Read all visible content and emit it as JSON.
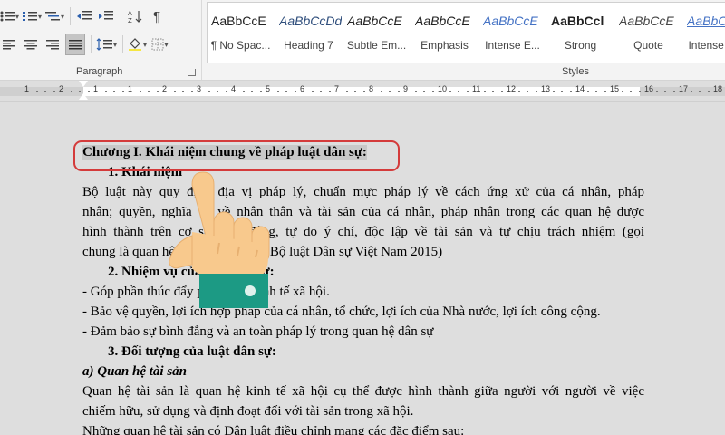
{
  "ribbon": {
    "paragraph_label": "Paragraph",
    "styles_label": "Styles",
    "styles": [
      {
        "sample": "AaBbCcE",
        "name": "¶ No Spac..."
      },
      {
        "sample": "AaBbCcDd",
        "name": "Heading 7"
      },
      {
        "sample": "AaBbCcE",
        "name": "Subtle Em..."
      },
      {
        "sample": "AaBbCcE",
        "name": "Emphasis"
      },
      {
        "sample": "AaBbCcE",
        "name": "Intense E..."
      },
      {
        "sample": "AaBbCcl",
        "name": "Strong"
      },
      {
        "sample": "AaBbCcE",
        "name": "Quote"
      },
      {
        "sample": "AaBbCcE",
        "name": "Intense Q..."
      }
    ]
  },
  "ruler": {
    "numbers": [
      "1",
      "2",
      "1",
      "1",
      "2",
      "3",
      "4",
      "5",
      "6",
      "7",
      "8",
      "9",
      "10",
      "11",
      "12",
      "13",
      "14",
      "15",
      "16",
      "17",
      "18"
    ]
  },
  "document": {
    "title": "Chương I. Khái niệm chung về pháp luật dân sự:",
    "lines": [
      "1.   Khái niệm",
      "Bộ luật này quy định địa vị pháp lý, chuẩn mực pháp lý về cách ứng xử của cá nhân, pháp",
      "nhân; quyền, nghĩa vụ về nhân thân và tài sản của cá nhân, pháp nhân trong các quan hệ được",
      "hình thành trên cơ sở bình đẳng, tự do ý chí, độc lập về tài sản và tự chịu trách nhiệm (gọi",
      "chung là quan hệ dân sự). (Điều 1 Bộ luật Dân sự Việt Nam 2015)",
      "2.   Nhiệm vụ của luật dân sự:",
      "- Góp phần thúc đẩy phát triển kinh tế xã hội.",
      "- Bảo vệ quyền, lợi ích hợp pháp của cá nhân, tổ chức, lợi ích của Nhà nước, lợi ích công cộng.",
      "- Đảm bảo sự bình đẳng và an toàn pháp lý trong quan hệ dân sự",
      "3.   Đối tượng của luật dân sự:",
      "a) Quan hệ tài sản",
      "Quan hệ tài sản là quan hệ kinh tế xã hội cụ thể được hình thành giữa người với người về việc",
      "chiếm hữu, sử dụng và định đoạt đối với tài sản trong xã hội.",
      "Những quan hệ tài sản có Dân luật điều chỉnh mang các đặc điểm sau:"
    ]
  }
}
